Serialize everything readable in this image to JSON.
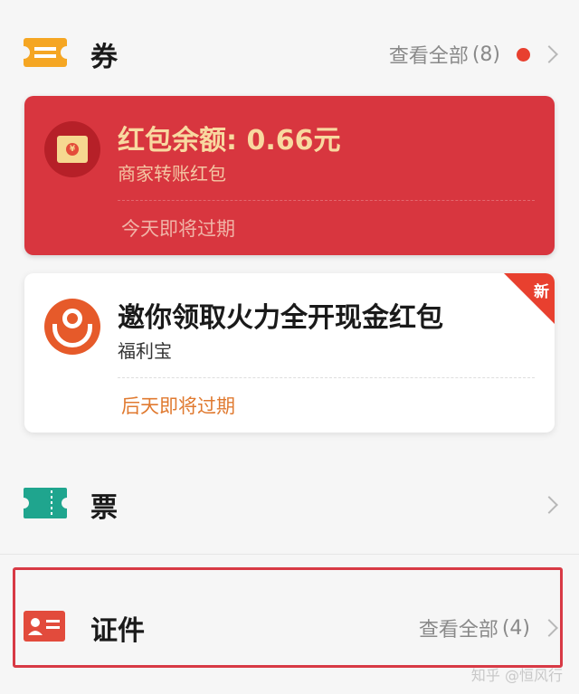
{
  "coupons": {
    "title": "券",
    "view_all": "查看全部",
    "count": "(8)"
  },
  "red_envelope_card": {
    "title": "红包余额: 0.66元",
    "subtitle": "商家转账红包",
    "expire": "今天即将过期",
    "icon_glyph": "¥"
  },
  "invite_card": {
    "title": "邀你领取火力全开现金红包",
    "subtitle": "福利宝",
    "expire": "后天即将过期",
    "badge": "新"
  },
  "tickets": {
    "title": "票"
  },
  "certificates": {
    "title": "证件",
    "view_all": "查看全部",
    "count": "(4)"
  },
  "watermark": "知乎 @恒风行",
  "colors": {
    "accent_red": "#d8363f",
    "coupon_icon": "#f5a623",
    "ticket_icon": "#1fa58e",
    "cert_icon": "#e24b3c",
    "highlight_border": "#d83a45"
  }
}
